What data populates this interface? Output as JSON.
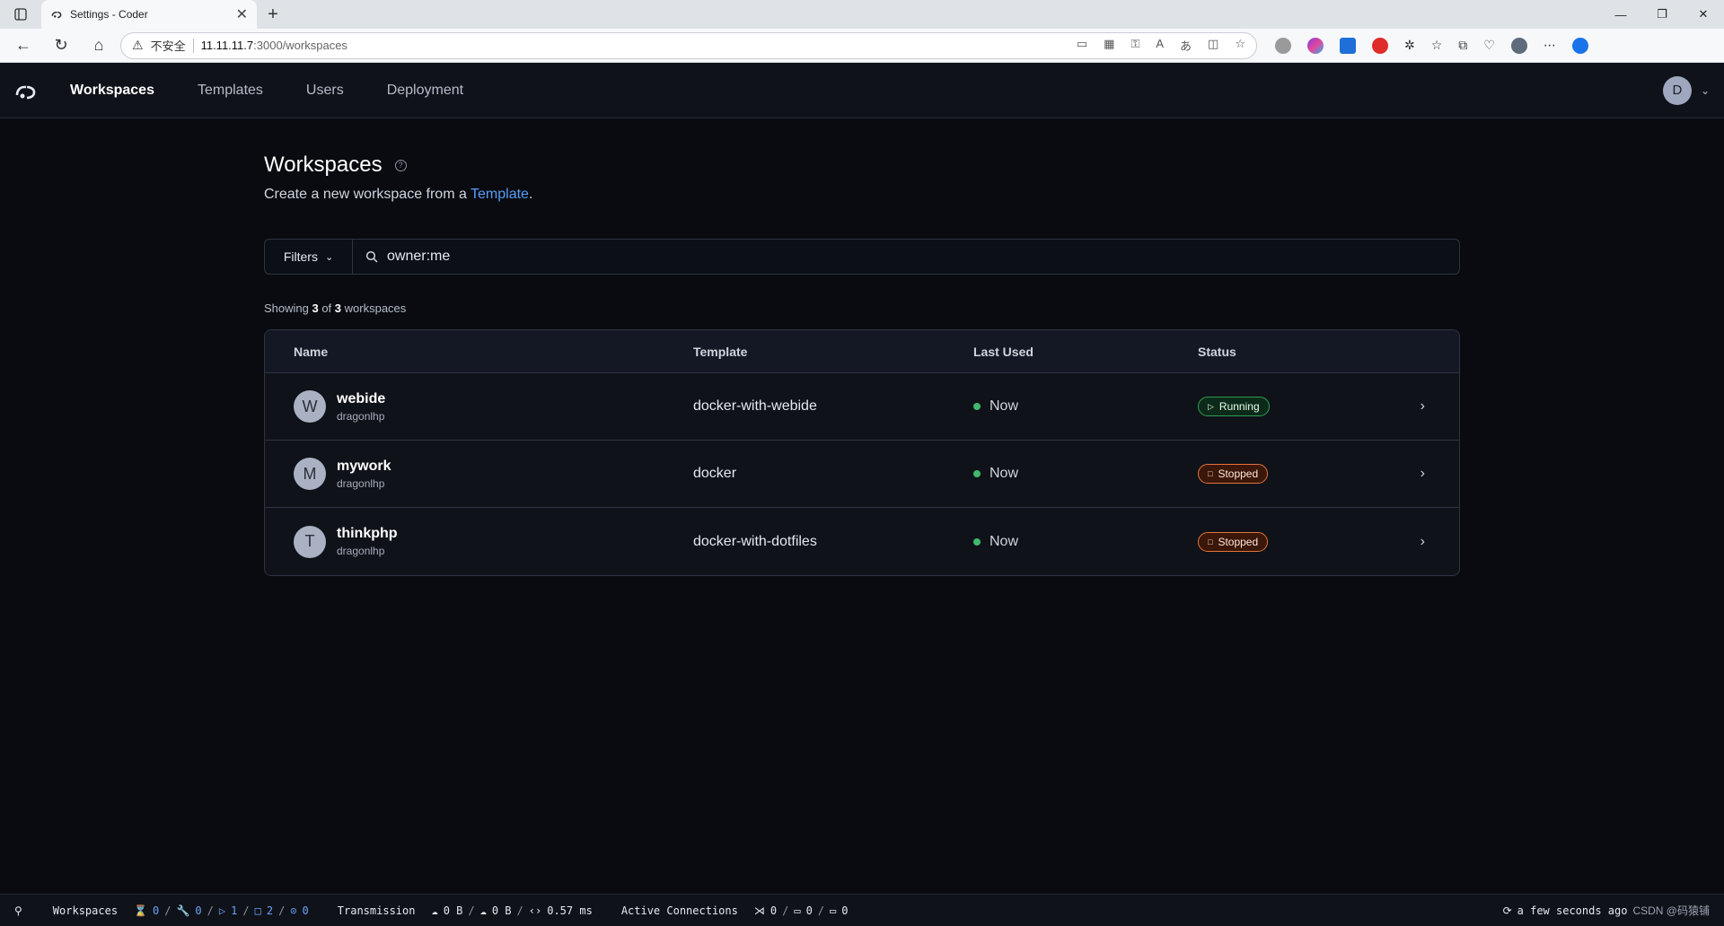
{
  "browser": {
    "tab_title": "Settings - Coder",
    "tab_close": "✕",
    "new_tab": "+",
    "insecure_label": "不安全",
    "url_host": "11.11.11.7",
    "url_path": ":3000/workspaces"
  },
  "header": {
    "nav": [
      "Workspaces",
      "Templates",
      "Users",
      "Deployment"
    ],
    "user_initial": "D"
  },
  "page": {
    "title": "Workspaces",
    "subtitle_prefix": "Create a new workspace from a ",
    "subtitle_link": "Template",
    "subtitle_suffix": "."
  },
  "filter": {
    "button_label": "Filters",
    "query": "owner:me"
  },
  "showing": {
    "prefix": "Showing ",
    "shown": "3",
    "of": " of ",
    "total": "3",
    "suffix": " workspaces"
  },
  "table": {
    "columns": [
      "Name",
      "Template",
      "Last Used",
      "Status"
    ],
    "rows": [
      {
        "initial": "W",
        "name": "webide",
        "owner": "dragonlhp",
        "template": "docker-with-webide",
        "last_used": "Now",
        "status": "Running"
      },
      {
        "initial": "M",
        "name": "mywork",
        "owner": "dragonlhp",
        "template": "docker",
        "last_used": "Now",
        "status": "Stopped"
      },
      {
        "initial": "T",
        "name": "thinkphp",
        "owner": "dragonlhp",
        "template": "docker-with-dotfiles",
        "last_used": "Now",
        "status": "Stopped"
      }
    ]
  },
  "statusbar": {
    "workspaces_label": "Workspaces",
    "ws_counts": [
      "0",
      "0",
      "1",
      "2",
      "0"
    ],
    "transmission_label": "Transmission",
    "tx_up": "0 B",
    "tx_down": "0 B",
    "latency": "0.57 ms",
    "active_label": "Active Connections",
    "conn_counts": [
      "0",
      "0",
      "0"
    ],
    "updated": "a few seconds ago",
    "watermark": "CSDN @码猿铺"
  },
  "colors": {
    "accent_link": "#5a9cf8",
    "running": "#2f9e55",
    "stopped": "#e2743a",
    "bg": "#090b10"
  }
}
